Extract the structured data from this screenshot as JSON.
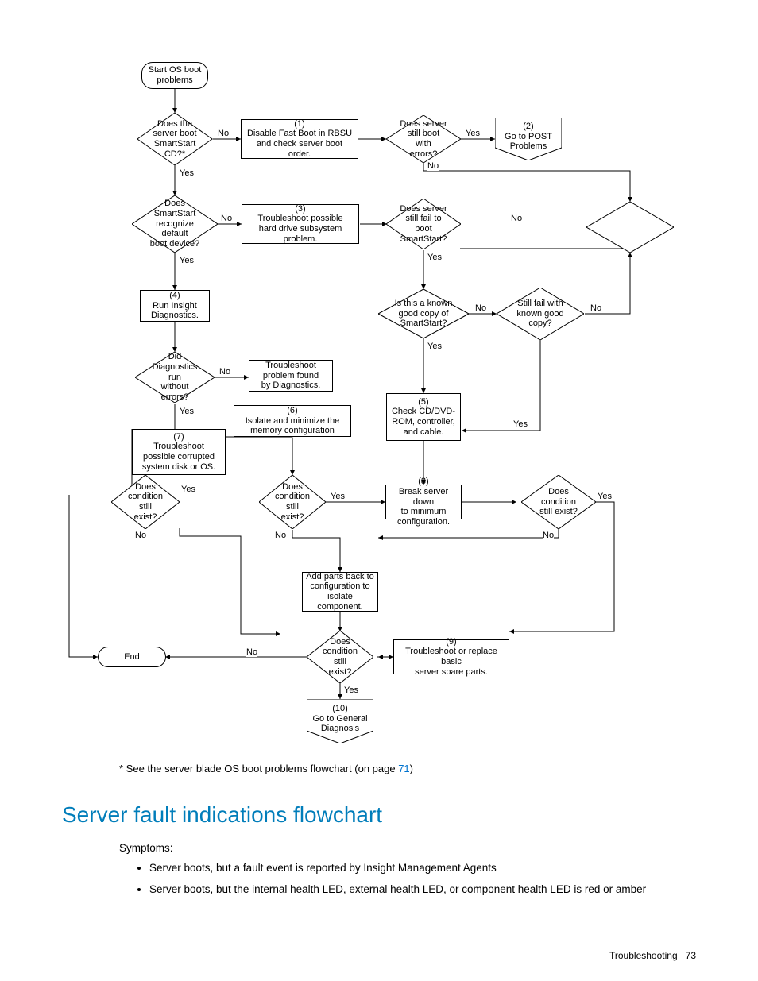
{
  "page": {
    "section": "Troubleshooting",
    "number": "73"
  },
  "note": {
    "prefix": "* See the server blade OS boot problems flowchart (on page ",
    "link": "71",
    "suffix": ")"
  },
  "heading": "Server fault indications flowchart",
  "symptoms_label": "Symptoms:",
  "bullets": [
    "Server boots, but a fault event is reported by Insight Management Agents",
    "Server boots, but the internal health LED, external health LED, or component health LED is red or amber"
  ],
  "flow": {
    "n_start": "Start OS boot\nproblems",
    "n_bootcd": "Does the\nserver boot\nSmartStart\nCD?*",
    "n_1": "(1)\nDisable Fast Boot in RBSU\nand check server boot\norder.",
    "n_stillerrors": "Does server\nstill boot with\nerrors?",
    "n_2": "(2)\nGo to POST\nProblems",
    "n_recognize": "Does\nSmartStart\nrecognize default\nboot device?",
    "n_3": "(3)\nTroubleshoot possible\nhard drive subsystem\nproblem.",
    "n_failboot": "Does server\nstill fail to boot\nSmartStart?",
    "n_4": "(4)\nRun Insight\nDiagnostics.",
    "n_knowngood": "Is this a known\ngood copy of\nSmartStart?",
    "n_stillfail": "Still fail with\nknown good\ncopy?",
    "n_diagerr": "Did\nDiagnostics run\nwithout errors?",
    "n_diagtrouble": "Troubleshoot\nproblem found\nby Diagnostics.",
    "n_5": "(5)\nCheck CD/DVD-\nROM, controller,\nand cable.",
    "n_6": "(6)\nIsolate and minimize the\nmemory configuration",
    "n_7": "(7)\nTroubleshoot\npossible corrupted\nsystem disk or OS.",
    "n_cond6": "Does\ncondition still\nexist?",
    "n_8": "(8)\nBreak server down\nto minimum configuration.",
    "n_cond8": "Does\ncondition\nstill exist?",
    "n_cond7": "Does\ncondition still\nexist?",
    "n_addparts": "Add parts back to\nconfiguration to\nisolate component.",
    "n_end": "End",
    "n_cond9": "Does\ncondition still\nexist?",
    "n_9": "(9)\nTroubleshoot or replace basic\nserver spare parts.",
    "n_10": "(10)\nGo to General\nDiagnosis"
  },
  "labels": {
    "yes": "Yes",
    "no": "No"
  }
}
